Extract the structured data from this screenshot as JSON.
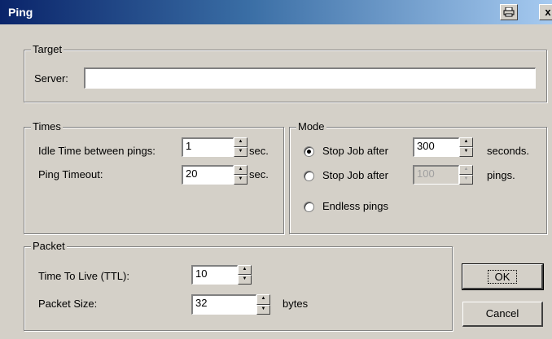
{
  "window": {
    "title": "Ping",
    "print_icon": "printer-icon",
    "close_glyph": "x"
  },
  "target": {
    "legend": "Target",
    "server_label": "Server:",
    "server_value": ""
  },
  "times": {
    "legend": "Times",
    "idle_label": "Idle Time between pings:",
    "idle_value": "1",
    "idle_unit": "sec.",
    "timeout_label": "Ping Timeout:",
    "timeout_value": "20",
    "timeout_unit": "sec."
  },
  "mode": {
    "legend": "Mode",
    "opt1_label": "Stop Job after",
    "opt1_value": "300",
    "opt1_unit": "seconds.",
    "opt1_selected": true,
    "opt2_label": "Stop Job after",
    "opt2_value": "100",
    "opt2_unit": "pings.",
    "opt2_selected": false,
    "opt3_label": "Endless pings",
    "opt3_selected": false
  },
  "packet": {
    "legend": "Packet",
    "ttl_label": "Time To Live (TTL):",
    "ttl_value": "10",
    "size_label": "Packet Size:",
    "size_value": "32",
    "size_unit": "bytes"
  },
  "buttons": {
    "ok": "OK",
    "cancel": "Cancel"
  }
}
